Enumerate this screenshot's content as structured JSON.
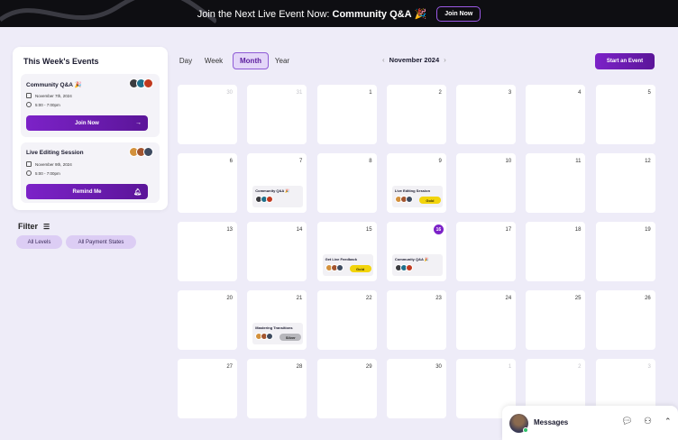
{
  "banner": {
    "text_prefix": "Join the Next Live Event Now: ",
    "text_highlight": "Community Q&A",
    "emoji": "🎉",
    "button": "Join Now"
  },
  "weekly": {
    "title": "This Week's Events",
    "events": [
      {
        "name": "Community Q&A 🎉",
        "date": "November 7th, 2024",
        "time": "5:00 - 7:00pm",
        "button": "Join Now",
        "button_icon": "arrow-right-icon"
      },
      {
        "name": "Live Editing Session",
        "date": "November 9th, 2024",
        "time": "5:00 - 7:00pm",
        "button": "Remind Me",
        "button_icon": "bell-icon"
      }
    ]
  },
  "filter": {
    "label": "Filter",
    "chips": [
      "All Levels",
      "All Payment States"
    ]
  },
  "views": {
    "tabs": [
      "Day",
      "Week",
      "Month",
      "Year"
    ],
    "active": "Month"
  },
  "month_label": "November 2024",
  "start_button": "Start an Event",
  "calendar": {
    "today": "16",
    "days": [
      {
        "n": "30",
        "other": true
      },
      {
        "n": "31",
        "other": true
      },
      {
        "n": "1"
      },
      {
        "n": "2"
      },
      {
        "n": "3"
      },
      {
        "n": "4"
      },
      {
        "n": "5"
      },
      {
        "n": "6"
      },
      {
        "n": "7",
        "event": {
          "name": "Community Q&A 🎉"
        }
      },
      {
        "n": "8"
      },
      {
        "n": "9",
        "event": {
          "name": "Live Editing Session",
          "badge": "Gold"
        }
      },
      {
        "n": "10"
      },
      {
        "n": "11"
      },
      {
        "n": "12"
      },
      {
        "n": "13"
      },
      {
        "n": "14"
      },
      {
        "n": "15",
        "event": {
          "name": "Get Live Feedback",
          "badge": "Gold"
        }
      },
      {
        "n": "16",
        "event": {
          "name": "Community Q&A 🎉"
        }
      },
      {
        "n": "17"
      },
      {
        "n": "18"
      },
      {
        "n": "19"
      },
      {
        "n": "20"
      },
      {
        "n": "21",
        "event": {
          "name": "Mastering Transitions",
          "badge": "Silver"
        }
      },
      {
        "n": "22"
      },
      {
        "n": "23"
      },
      {
        "n": "24"
      },
      {
        "n": "25"
      },
      {
        "n": "26"
      },
      {
        "n": "27"
      },
      {
        "n": "28"
      },
      {
        "n": "29"
      },
      {
        "n": "30"
      },
      {
        "n": "1",
        "other": true
      },
      {
        "n": "2",
        "other": true
      },
      {
        "n": "3",
        "other": true
      }
    ]
  },
  "messages": {
    "label": "Messages"
  },
  "colors": {
    "accent": "#7c22c8",
    "gold": "#f2d40c",
    "silver": "#b7b7bc",
    "background": "#eeecf8"
  }
}
